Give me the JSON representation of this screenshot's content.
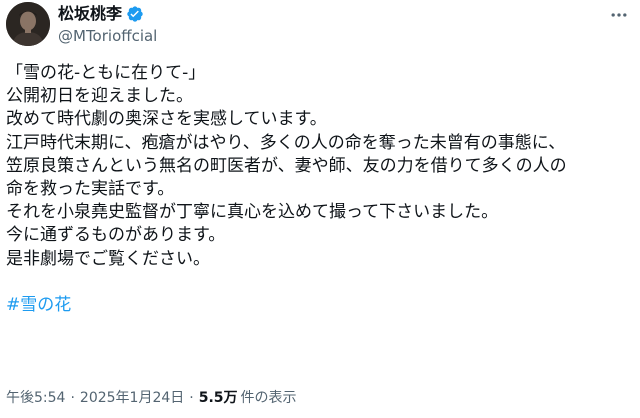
{
  "author": {
    "display_name": "松坂桃李",
    "handle": "@MTorioffcial",
    "verified": true,
    "verified_color": "#1d9bf0"
  },
  "more_icon": "more-horizontal-icon",
  "tweet": {
    "lines": [
      "「雪の花-ともに在りて-」",
      "公開初日を迎えました。",
      "改めて時代劇の奥深さを実感しています。",
      "江戸時代末期に、疱瘡がはやり、多くの人の命を奪った未曾有の事態に、",
      "笠原良策さんという無名の町医者が、妻や師、友の力を借りて多くの人の",
      "命を救った実話です。",
      "それを小泉堯史監督が丁寧に真心を込めて撮って下さいました。",
      "今に通ずるものがあります。",
      "是非劇場でご覧ください。"
    ],
    "hashtag": "#雪の花",
    "hashtag_color": "#1d9bf0"
  },
  "meta": {
    "time": "午後5:54",
    "separator": "·",
    "date": "2025年1月24日",
    "views_count": "5.5万",
    "views_label": "件の表示"
  }
}
